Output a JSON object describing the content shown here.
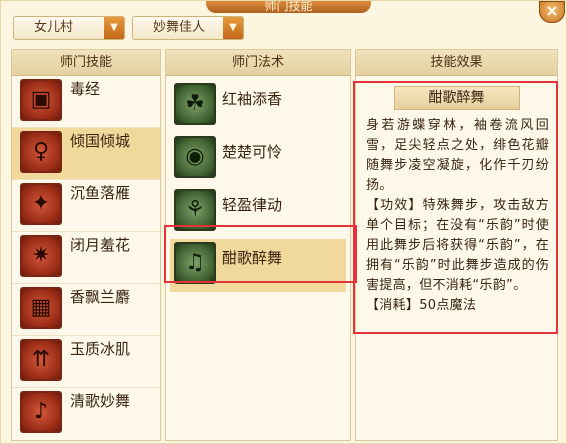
{
  "window": {
    "title": "师门技能"
  },
  "dropdowns": {
    "school": "女儿村",
    "career": "妙舞佳人"
  },
  "panels": {
    "skills": {
      "header": "师门技能",
      "items": [
        {
          "label": "毒经",
          "icon": "poison-sutra-icon",
          "selected": false
        },
        {
          "label": "倾国倾城",
          "icon": "beauty-icon",
          "selected": true
        },
        {
          "label": "沉鱼落雁",
          "icon": "fish-goose-icon",
          "selected": false
        },
        {
          "label": "闭月羞花",
          "icon": "moon-flower-icon",
          "selected": false
        },
        {
          "label": "香飘兰麝",
          "icon": "fragrance-icon",
          "selected": false
        },
        {
          "label": "玉质冰肌",
          "icon": "jade-ice-icon",
          "selected": false
        },
        {
          "label": "清歌妙舞",
          "icon": "song-dance-icon",
          "selected": false
        }
      ]
    },
    "spells": {
      "header": "师门法术",
      "items": [
        {
          "label": "红袖添香",
          "icon": "red-sleeve-icon",
          "selected": false
        },
        {
          "label": "楚楚可怜",
          "icon": "pitiful-eye-icon",
          "selected": false
        },
        {
          "label": "轻盈律动",
          "icon": "light-rhythm-icon",
          "selected": false
        },
        {
          "label": "酣歌醉舞",
          "icon": "drunk-dance-icon",
          "selected": true
        }
      ]
    },
    "effect": {
      "header": "技能效果",
      "name": "酣歌醉舞",
      "description": "身若游蝶穿林，袖卷流风回雪，足尖轻点之处，绯色花瓣随舞步凌空凝旋，化作千刃纷扬。",
      "function_text": "【功效】特殊舞步，攻击敌方单个目标；在没有“乐韵”时使用此舞步后将获得“乐韵”，在拥有“乐韵”时此舞步造成的伤害提高，但不消耗“乐韵”。",
      "cost_text": "【消耗】50点魔法"
    }
  },
  "colors": {
    "highlight": "#e4333a",
    "selected_row": "#f1d99c",
    "accent": "#c2681b"
  }
}
